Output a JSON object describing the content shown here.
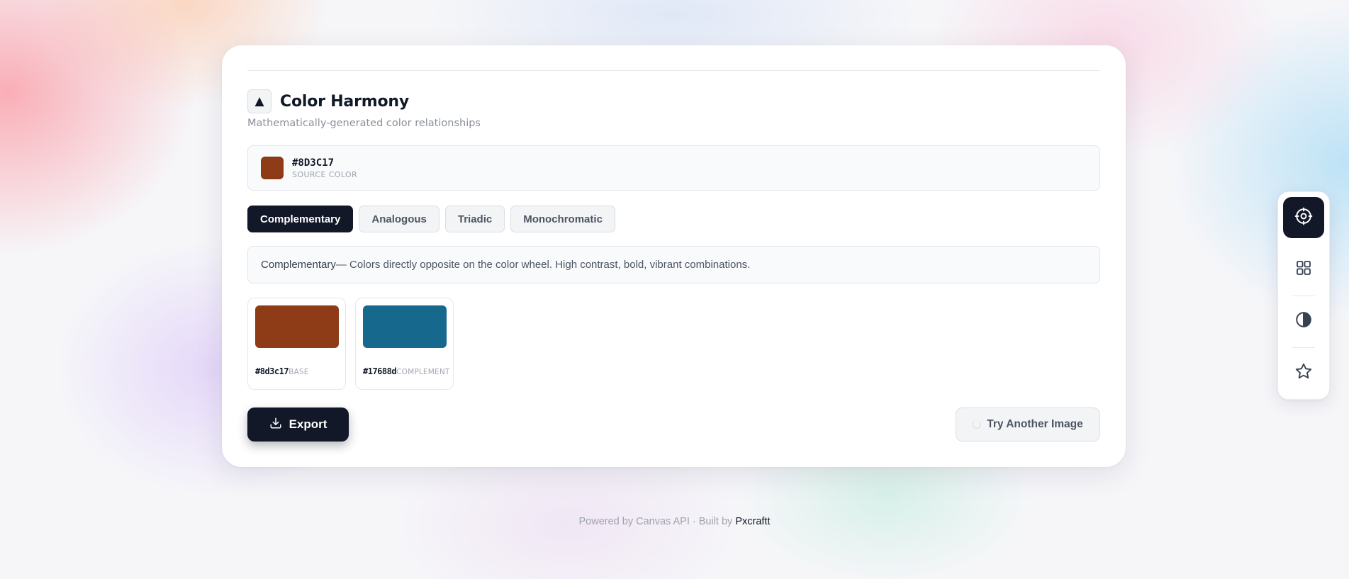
{
  "panel": {
    "title": "Color Harmony",
    "subtitle": "Mathematically-generated color relationships",
    "header_icon": "▲"
  },
  "source": {
    "hex": "#8D3C17",
    "label": "SOURCE COLOR",
    "color": "#8d3c17"
  },
  "tabs": [
    {
      "label": "Complementary",
      "active": true
    },
    {
      "label": "Analogous",
      "active": false
    },
    {
      "label": "Triadic",
      "active": false
    },
    {
      "label": "Monochromatic",
      "active": false
    }
  ],
  "description": {
    "name": "Complementary",
    "text": " — Colors directly opposite on the color wheel. High contrast, bold, vibrant combinations."
  },
  "swatches": [
    {
      "hex": "#8d3c17",
      "role": "BASE",
      "color": "#8d3c17"
    },
    {
      "hex": "#17688d",
      "role": "COMPLEMENT",
      "color": "#17688d"
    }
  ],
  "actions": {
    "export_label": "Export",
    "try_label": "Try Another Image"
  },
  "footer": {
    "text": "Powered by Canvas API · Built by ",
    "link": "Pxcraftt"
  },
  "toolbar": {
    "tools": [
      "target-icon",
      "grid-icon",
      "contrast-icon",
      "star-icon"
    ],
    "active": "target-icon"
  },
  "colors": {
    "accent_dark": "#121828"
  }
}
